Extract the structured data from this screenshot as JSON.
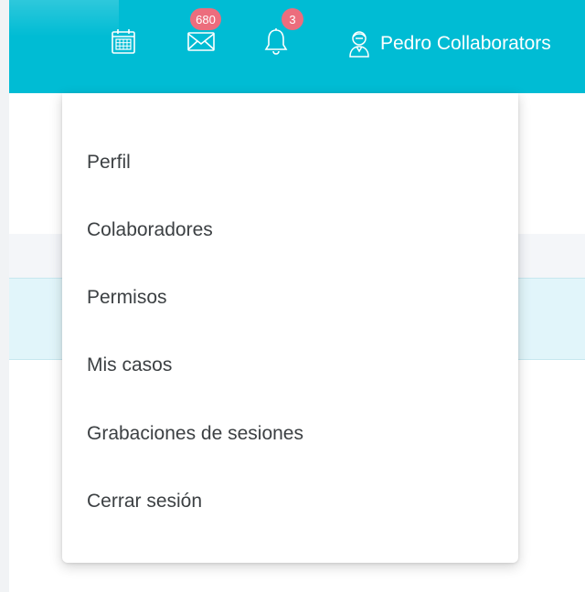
{
  "header": {
    "icons": {
      "calendar": "calendar-icon",
      "mail": "mail-icon",
      "bell": "bell-icon",
      "user": "user-avatar-icon"
    },
    "mail_badge": "680",
    "bell_badge": "3",
    "user_name": "Pedro Collaborators"
  },
  "dropdown": {
    "items": [
      {
        "label": "Perfil"
      },
      {
        "label": "Colaboradores"
      },
      {
        "label": "Permisos"
      },
      {
        "label": "Mis casos"
      },
      {
        "label": "Grabaciones de sesiones"
      },
      {
        "label": "Cerrar sesión"
      }
    ]
  },
  "colors": {
    "header": "#00bcd4",
    "badge": "#ec6d7d",
    "menu_text": "#3c4043"
  }
}
